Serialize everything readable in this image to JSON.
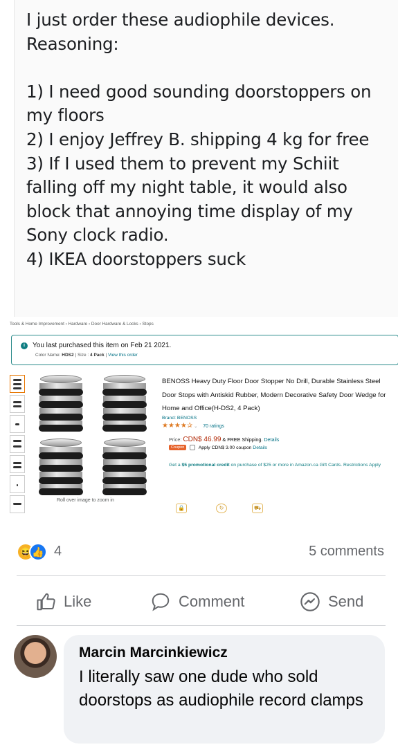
{
  "post": {
    "text": "I just order these audiophile devices.\nReasoning:\n\n1) I need good sounding doorstoppers on my floors\n2) I enjoy Jeffrey B. shipping 4 kg for free\n3) If I used them to prevent my Schiit falling off my night table, it would also block that annoying time display of my Sony clock radio.\n4) IKEA doorstoppers suck"
  },
  "screenshot": {
    "breadcrumb": "Tools & Home Improvement › Hardware › Door Hardware & Locks › Stops",
    "purchased_msg": "You last purchased this item on Feb 21 2021.",
    "meta_color_label": "Color Name:",
    "meta_color": "HDS2",
    "meta_size_label": "Size :",
    "meta_size": "4 Pack",
    "view_order": "View this order",
    "title": "BENOSS Heavy Duty Floor Door Stopper No Drill, Durable Stainless Steel Door Stops with Antiskid Rubber, Modern Decorative Safety Door Wedge for Home and Office(H-DS2, 4 Pack)",
    "brand": "Brand: BENOSS",
    "stars": "★★★★✰",
    "ratings": "70 ratings",
    "price_label": "Price:",
    "price": "CDN$ 46.99",
    "shipping": "& FREE Shipping.",
    "details_link": "Details",
    "coupon_tag": "Coupon",
    "coupon_text": "Apply CDN$ 3.00 coupon",
    "promo_prefix": "Get a",
    "promo_bold": "$5 promotional credit",
    "promo_rest": "on purchase of $25 or more in Amazon.ca Gift Cards. Restrictions Apply",
    "zoom_hint": "Roll over image to zoom in"
  },
  "reactions": {
    "count": "4",
    "comments": "5 comments",
    "haha_icon": "haha-emoji-icon",
    "like_icon": "like-thumb-icon"
  },
  "actions": {
    "like": "Like",
    "comment": "Comment",
    "send": "Send"
  },
  "comment": {
    "author": "Marcin Marcinkiewicz",
    "text": "I literally saw one dude who sold doorstops as audiophile record clamps"
  },
  "colors": {
    "facebook_blue": "#1877f2",
    "muted_text": "#65676b",
    "bubble_bg": "#f0f2f5",
    "amazon_link": "#007185",
    "price_red": "#b12704"
  }
}
